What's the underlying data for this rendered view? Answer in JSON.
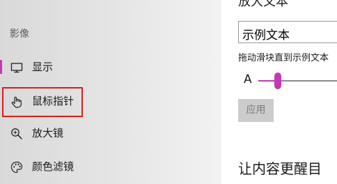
{
  "sidebar": {
    "section_header": "影像",
    "items": [
      {
        "label": "显示",
        "icon": "monitor-icon",
        "selected": true
      },
      {
        "label": "鼠标指针",
        "icon": "mouse-pointer-hand-icon",
        "highlighted": true
      },
      {
        "label": "放大镜",
        "icon": "magnifier-icon"
      },
      {
        "label": "颜色滤镜",
        "icon": "color-palette-icon"
      }
    ]
  },
  "main": {
    "cut_title": "放大文本",
    "sample_text": "示例文本",
    "slider_caption": "拖动滑块直到示例文本",
    "slider_letter": "A",
    "apply_label": "应用",
    "section_title": "让内容更醒目"
  },
  "colors": {
    "accent": "#c239b3",
    "highlight_box": "#e01a1a"
  }
}
